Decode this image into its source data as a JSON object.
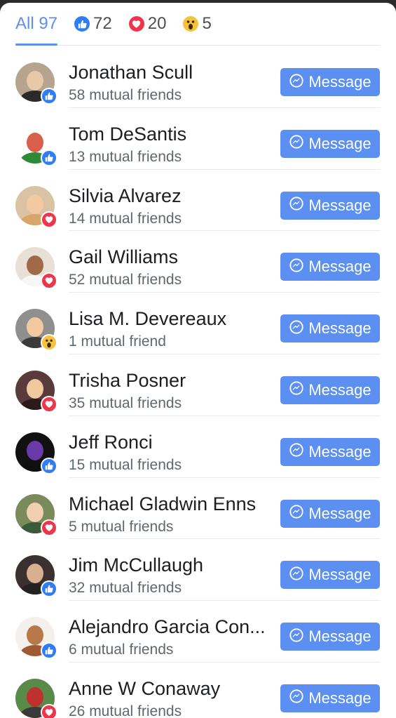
{
  "tabs": [
    {
      "label": "All 97",
      "icon": null,
      "active": true
    },
    {
      "label": "72",
      "icon": "like-icon",
      "active": false
    },
    {
      "label": "20",
      "icon": "love-icon",
      "active": false
    },
    {
      "label": "5",
      "icon": "wow-icon",
      "active": false
    }
  ],
  "colors": {
    "accent": "#5b8ff2",
    "like": "#2e7cf6",
    "love": "#f0344c",
    "wow": "#f7c23b"
  },
  "message_label": "Message",
  "people": [
    {
      "name": "Jonathan Scull",
      "mutual": "58 mutual friends",
      "reaction": "like"
    },
    {
      "name": "Tom DeSantis",
      "mutual": "13 mutual friends",
      "reaction": "like"
    },
    {
      "name": "Silvia Alvarez",
      "mutual": "14 mutual friends",
      "reaction": "love"
    },
    {
      "name": "Gail Williams",
      "mutual": "52 mutual friends",
      "reaction": "love"
    },
    {
      "name": "Lisa M. Devereaux",
      "mutual": "1 mutual friend",
      "reaction": "wow"
    },
    {
      "name": "Trisha Posner",
      "mutual": "35 mutual friends",
      "reaction": "love"
    },
    {
      "name": "Jeff Ronci",
      "mutual": "15 mutual friends",
      "reaction": "like"
    },
    {
      "name": "Michael Gladwin Enns",
      "mutual": "5 mutual friends",
      "reaction": "love"
    },
    {
      "name": "Jim McCullaugh",
      "mutual": "32 mutual friends",
      "reaction": "like"
    },
    {
      "name": "Alejandro Garcia Con...",
      "mutual": "6 mutual friends",
      "reaction": "like"
    },
    {
      "name": "Anne W Conaway",
      "mutual": "26 mutual friends",
      "reaction": "love"
    }
  ]
}
